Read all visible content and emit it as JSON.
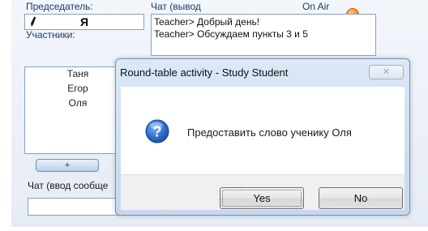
{
  "app": {
    "chair_label": "Председатель:",
    "chair_name": "Я",
    "chat_output_label": "Чат (вывод",
    "on_air_label": "On Air",
    "chat_lines": [
      "Teacher> Добрый день!",
      "Teacher> Обсуждаем пункты 3 и 5"
    ],
    "participants_label": "Участники:",
    "participants": [
      "Таня",
      "Егор",
      "Оля"
    ],
    "plus_label": "+",
    "chat_input_label": "Чат (ввод сообще",
    "on_air_color": "#ff8a1c"
  },
  "dialog": {
    "title": "Round-table activity - Study Student",
    "message": "Предоставить слово ученику Оля",
    "icon": "question-icon",
    "yes_label": "Yes",
    "no_label": "No"
  }
}
